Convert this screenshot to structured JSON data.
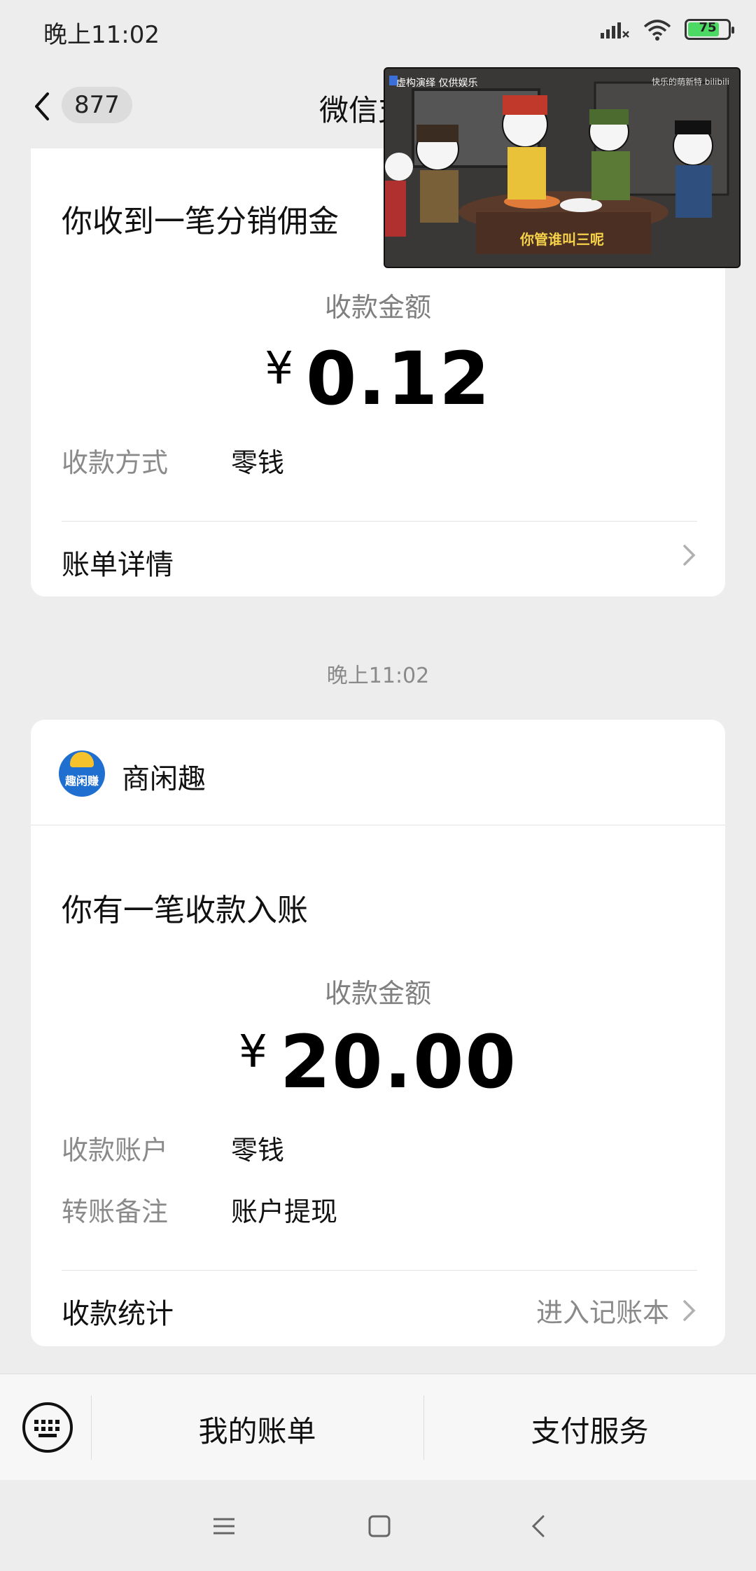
{
  "status_bar": {
    "time": "晚上11:02",
    "battery_level": "75"
  },
  "nav": {
    "unread_count": "877",
    "title": "微信支付"
  },
  "video_overlay": {
    "caption_left": "虚构演绎 仅供娱乐",
    "caption_right": "快乐的萌新特 bilibili",
    "subtitle": "你管谁叫三呢"
  },
  "card1": {
    "heading": "你收到一笔分销佣金",
    "amount_label": "收款金额",
    "currency": "¥",
    "amount": "0.12",
    "rows": [
      {
        "label": "收款方式",
        "value": "零钱"
      }
    ],
    "link_label": "账单详情"
  },
  "timestamp": "晚上11:02",
  "card2": {
    "merchant_name": "商闲趣",
    "merchant_logo_text": "趣闲赚",
    "heading": "你有一笔收款入账",
    "amount_label": "收款金额",
    "currency": "¥",
    "amount": "20.00",
    "rows": [
      {
        "label": "收款账户",
        "value": "零钱"
      },
      {
        "label": "转账备注",
        "value": "账户提现"
      }
    ],
    "link_label": "收款统计",
    "link_right": "进入记账本"
  },
  "bottom_bar": {
    "item1": "我的账单",
    "item2": "支付服务"
  },
  "icons": [
    "back-arrow-icon",
    "signal-icon",
    "wifi-icon",
    "battery-icon",
    "chevron-right-icon",
    "keyboard-icon",
    "menu-icon",
    "home-icon",
    "back-icon"
  ]
}
